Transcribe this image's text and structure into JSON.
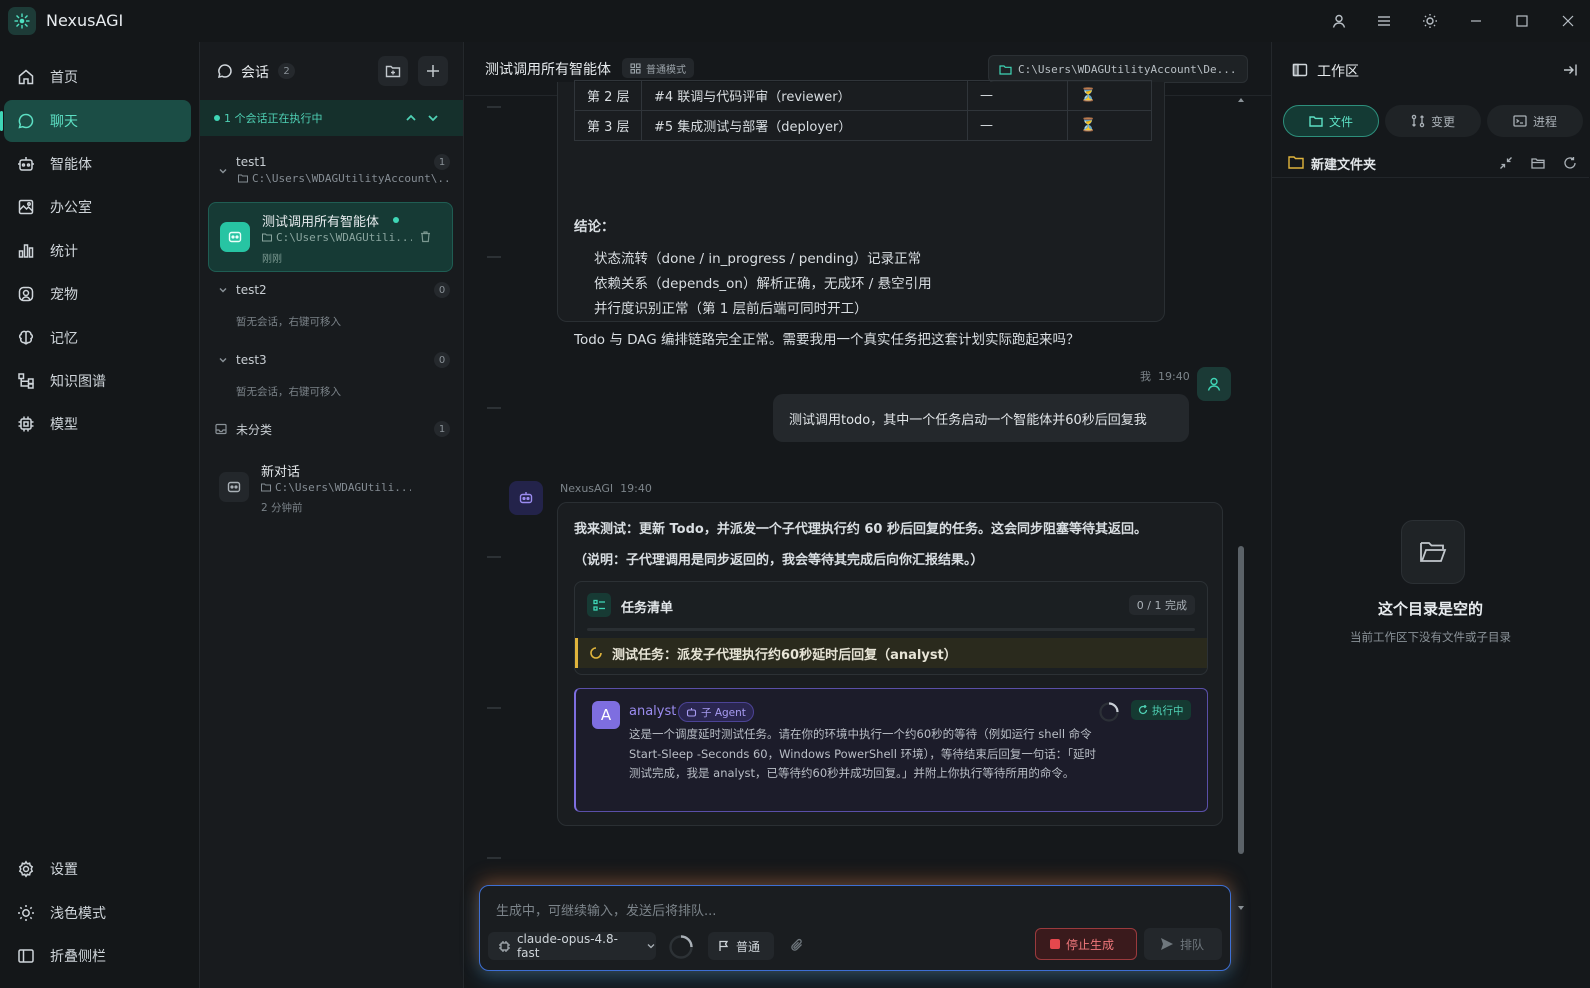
{
  "app": {
    "name": "NexusAGI"
  },
  "nav": {
    "items": [
      {
        "label": "首页",
        "icon": "home-icon"
      },
      {
        "label": "聊天",
        "icon": "chat-icon",
        "active": true
      },
      {
        "label": "智能体",
        "icon": "robot-icon"
      },
      {
        "label": "办公室",
        "icon": "office-icon"
      },
      {
        "label": "统计",
        "icon": "bar-chart-icon"
      },
      {
        "label": "宠物",
        "icon": "pet-icon"
      },
      {
        "label": "记忆",
        "icon": "brain-icon"
      },
      {
        "label": "知识图谱",
        "icon": "graph-icon"
      },
      {
        "label": "模型",
        "icon": "chip-icon"
      }
    ],
    "bottom": [
      {
        "label": "设置",
        "icon": "gear-icon"
      },
      {
        "label": "浅色模式",
        "icon": "sun-icon"
      },
      {
        "label": "折叠侧栏",
        "icon": "sidebar-icon"
      }
    ]
  },
  "sessions": {
    "title": "会话",
    "count": "2",
    "running": "1 个会话正在执行中",
    "groups": [
      {
        "name": "test1",
        "count": "1",
        "path": "C:\\Users\\WDAGUtilityAccount\\..."
      },
      {
        "name": "test2",
        "count": "0",
        "empty": "暂无会话，右键可移入"
      },
      {
        "name": "test3",
        "count": "0",
        "empty": "暂无会话，右键可移入"
      },
      {
        "name": "未分类",
        "count": "1"
      }
    ],
    "active": {
      "title": "测试调用所有智能体",
      "path": "C:\\Users\\WDAGUtili...",
      "time": "刚刚"
    },
    "other": {
      "title": "新对话",
      "path": "C:\\Users\\WDAGUtili...",
      "time": "2 分钟前"
    }
  },
  "chat": {
    "title": "测试调用所有智能体",
    "mode": "普通模式",
    "path": "C:\\Users\\WDAGUtilityAccount\\De...",
    "table": [
      {
        "layer": "第 2 层",
        "task": "#4 联调与代码评审（reviewer）",
        "dep": "—",
        "status": "⏳"
      },
      {
        "layer": "第 3 层",
        "task": "#5 集成测试与部署（deployer）",
        "dep": "—",
        "status": "⏳"
      }
    ],
    "conclusion_title": "结论：",
    "conclusion_items": [
      "状态流转（done / in_progress / pending）记录正常",
      "依赖关系（depends_on）解析正确，无成环 / 悬空引用",
      "并行度识别正常（第 1 层前后端可同时开工）"
    ],
    "conclusion_end": "Todo 与 DAG 编排链路完全正常。需要我用一个真实任务把这套计划实际跑起来吗？",
    "user_meta_name": "我",
    "user_meta_time": "19:40",
    "user_msg": "测试调用todo，其中一个任务启动一个智能体并60秒后回复我",
    "bot_name": "NexusAGI",
    "bot_time": "19:40",
    "bot_line1": "我来测试：更新 Todo，并派发一个子代理执行约 60 秒后回复的任务。这会同步阻塞等待其返回。",
    "bot_line2": "（说明：子代理调用是同步返回的，我会等待其完成后向你汇报结果。）",
    "todo_title": "任务清单",
    "todo_progress": "0 / 1 完成",
    "todo_item": "测试任务：派发子代理执行约60秒延时后回复（analyst）",
    "agent_initial": "A",
    "agent_name": "analyst",
    "agent_tag": "子 Agent",
    "agent_status": "执行中",
    "agent_desc": "这是一个调度延时测试任务。请在你的环境中执行一个约60秒的等待（例如运行 shell 命令 Start-Sleep -Seconds 60，Windows PowerShell 环境），等待结束后回复一句话：「延时测试完成，我是 analyst，已等待约60秒并成功回复。」并附上你执行等待所用的命令。"
  },
  "input": {
    "placeholder": "生成中，可继续输入，发送后将排队...",
    "model": "claude-opus-4.8-fast",
    "mode": "普通",
    "stop": "停止生成",
    "queue": "排队"
  },
  "workspace": {
    "title": "工作区",
    "tabs": [
      "文件",
      "变更",
      "进程"
    ],
    "folder": "新建文件夹",
    "empty_title": "这个目录是空的",
    "empty_sub": "当前工作区下没有文件或子目录"
  },
  "colors": {
    "accent": "#3fd6b6",
    "agent": "#7e6ee0",
    "danger": "#e5484d"
  }
}
